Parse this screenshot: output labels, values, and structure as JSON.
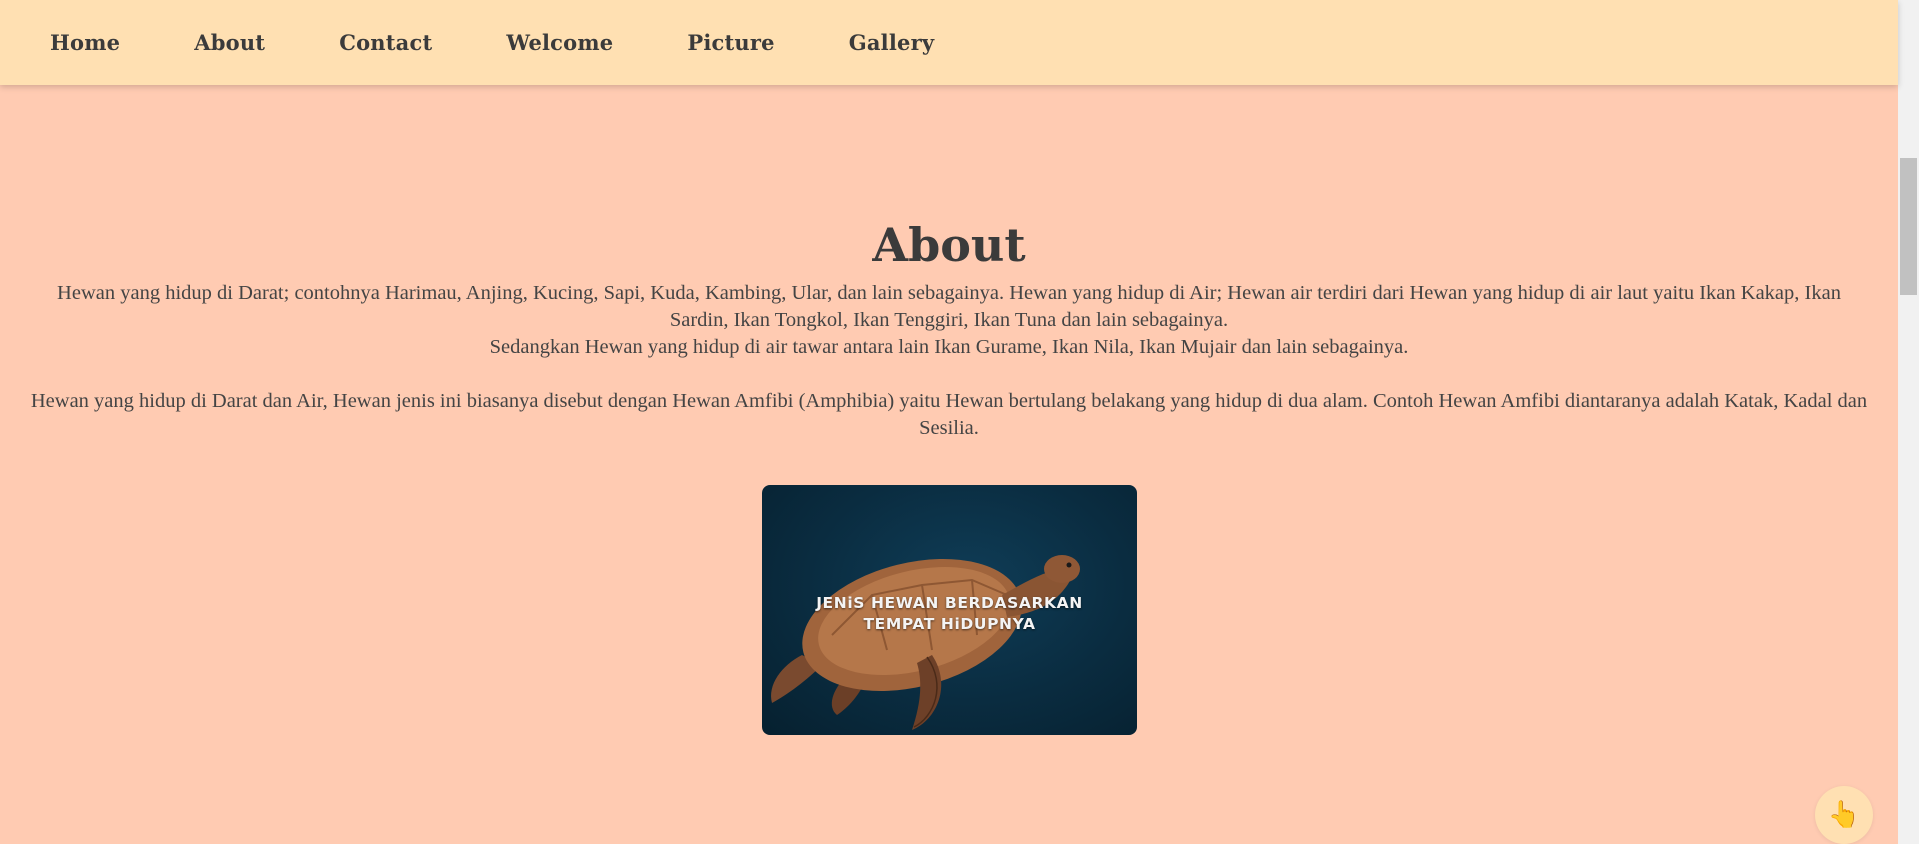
{
  "nav": {
    "items": [
      {
        "label": "Home"
      },
      {
        "label": "About"
      },
      {
        "label": "Contact"
      },
      {
        "label": "Welcome"
      },
      {
        "label": "Picture"
      },
      {
        "label": "Gallery"
      }
    ]
  },
  "about": {
    "title": "About",
    "paragraph1": "Hewan yang hidup di Darat; contohnya Harimau, Anjing, Kucing, Sapi, Kuda, Kambing, Ular, dan lain sebagainya. Hewan yang hidup di Air; Hewan air terdiri dari Hewan yang hidup di air laut yaitu Ikan Kakap, Ikan Sardin, Ikan Tongkol, Ikan Tenggiri, Ikan Tuna dan lain sebagainya.",
    "paragraph2": "Sedangkan Hewan yang hidup di air tawar antara lain Ikan Gurame, Ikan Nila, Ikan Mujair dan lain sebagainya.",
    "paragraph3": "Hewan yang hidup di Darat dan Air, Hewan jenis ini biasanya disebut dengan Hewan Amfibi (Amphibia) yaitu Hewan bertulang belakang yang hidup di dua alam. Contoh Hewan Amfibi diantaranya adalah Katak, Kadal dan Sesilia.",
    "image": {
      "caption_line1": "JENiS HEWAN BERDASARKAN",
      "caption_line2": "TEMPAT HiDUPNYA",
      "subject_icon": "sea-turtle-illustration"
    }
  },
  "fab": {
    "icon": "pointing-hand-icon",
    "glyph": "👆"
  },
  "colors": {
    "background": "#ffcbb2",
    "navbar": "#ffe0b2",
    "text": "#3b3b3b",
    "image_bg": "#0a2c40"
  }
}
